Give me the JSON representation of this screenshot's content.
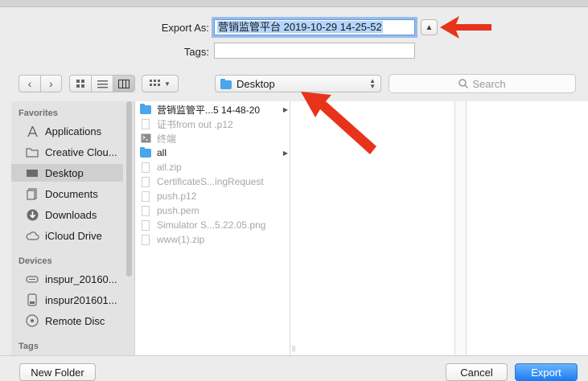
{
  "dialog": {
    "export_as_label": "Export As:",
    "export_as_value": "营销监管平台 2019-10-29 14-25-52",
    "tags_label": "Tags:",
    "tags_value": ""
  },
  "toolbar": {
    "back_icon": "chevron-left-icon",
    "forward_icon": "chevron-right-icon",
    "location": "Desktop",
    "search_placeholder": "Search"
  },
  "sidebar": {
    "favorites_heading": "Favorites",
    "favorites": [
      {
        "label": "Applications",
        "icon": "applications-icon"
      },
      {
        "label": "Creative Clou...",
        "icon": "folder-icon"
      },
      {
        "label": "Desktop",
        "icon": "desktop-icon",
        "selected": true
      },
      {
        "label": "Documents",
        "icon": "documents-icon"
      },
      {
        "label": "Downloads",
        "icon": "downloads-icon"
      },
      {
        "label": "iCloud Drive",
        "icon": "cloud-icon"
      }
    ],
    "devices_heading": "Devices",
    "devices": [
      {
        "label": "inspur_20160...",
        "icon": "disk-icon"
      },
      {
        "label": "inspur201601...",
        "icon": "external-disk-icon"
      },
      {
        "label": "Remote Disc",
        "icon": "disc-icon"
      }
    ],
    "tags_heading": "Tags"
  },
  "files": [
    {
      "name": "营销监管平...5 14-48-20",
      "type": "folder",
      "enabled": true,
      "has_children": true
    },
    {
      "name": "证书from out .p12",
      "type": "file",
      "enabled": false
    },
    {
      "name": "终端",
      "type": "terminal",
      "enabled": false
    },
    {
      "name": "all",
      "type": "folder",
      "enabled": true,
      "has_children": true
    },
    {
      "name": "all.zip",
      "type": "file",
      "enabled": false
    },
    {
      "name": "CertificateS...ingRequest",
      "type": "file",
      "enabled": false
    },
    {
      "name": "push.p12",
      "type": "file",
      "enabled": false
    },
    {
      "name": "push.pem",
      "type": "file",
      "enabled": false
    },
    {
      "name": "Simulator S...5.22.05.png",
      "type": "file",
      "enabled": false
    },
    {
      "name": "www(1).zip",
      "type": "file",
      "enabled": false
    }
  ],
  "buttons": {
    "new_folder": "New Folder",
    "cancel": "Cancel",
    "export": "Export"
  },
  "colors": {
    "accent": "#1c7ef4",
    "folder": "#48a6ea",
    "annotation_arrow": "#e8331c"
  }
}
